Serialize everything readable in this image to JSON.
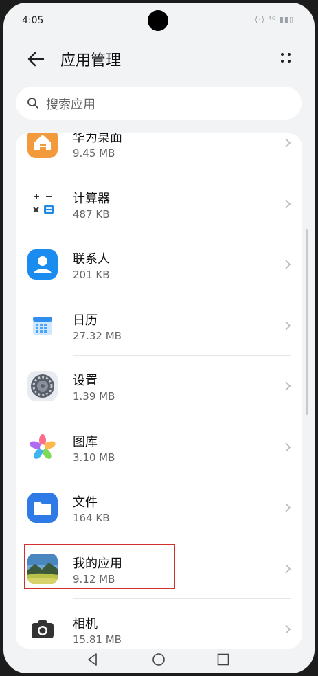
{
  "status": {
    "time": "4:05",
    "icons": "⟨·⟩ ⁴ᴳ ▮▮▯"
  },
  "header": {
    "title": "应用管理"
  },
  "search": {
    "placeholder": "搜索应用"
  },
  "apps": [
    {
      "name": "华为桌面",
      "size": "9.45 MB",
      "icon": "home-icon"
    },
    {
      "name": "计算器",
      "size": "487 KB",
      "icon": "calculator-icon"
    },
    {
      "name": "联系人",
      "size": "201 KB",
      "icon": "contacts-icon"
    },
    {
      "name": "日历",
      "size": "27.32 MB",
      "icon": "calendar-icon"
    },
    {
      "name": "设置",
      "size": "1.39 MB",
      "icon": "settings-gear-icon"
    },
    {
      "name": "图库",
      "size": "3.10 MB",
      "icon": "gallery-icon"
    },
    {
      "name": "文件",
      "size": "164 KB",
      "icon": "folder-icon"
    },
    {
      "name": "我的应用",
      "size": "9.12 MB",
      "icon": "landscape-app-icon"
    },
    {
      "name": "相机",
      "size": "15.81 MB",
      "icon": "camera-icon"
    }
  ],
  "colors": {
    "accent": "#1e88e5",
    "highlight": "#d32f2f",
    "background": "#f1f3f5"
  }
}
